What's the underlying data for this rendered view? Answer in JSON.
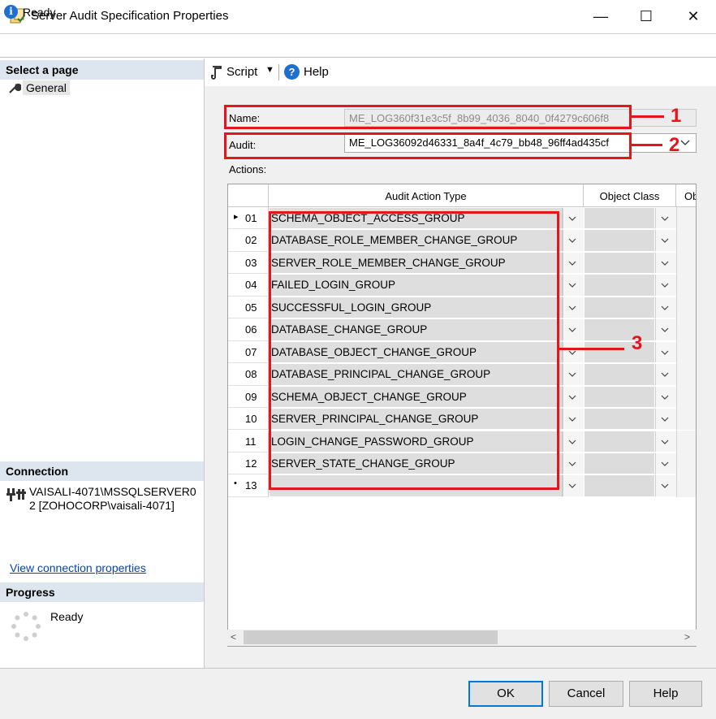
{
  "window": {
    "title": "Server Audit Specification Properties",
    "minimize": "—",
    "maximize": "☐",
    "close": "✕"
  },
  "status": {
    "text": "Ready"
  },
  "left": {
    "select_page": "Select a page",
    "pages": [
      {
        "label": "General"
      }
    ],
    "connection_header": "Connection",
    "connection_text": "VAISALI-4071\\MSSQLSERVER02 [ZOHOCORP\\vaisali-4071]",
    "view_connection": "View connection properties",
    "progress_header": "Progress",
    "progress_text": "Ready"
  },
  "toolbar": {
    "script": "Script",
    "help": "Help"
  },
  "form": {
    "name_label": "Name:",
    "name_value": "ME_LOG360f31e3c5f_8b99_4036_8040_0f4279c606f8",
    "audit_label": "Audit:",
    "audit_value": "ME_LOG36092d46331_8a4f_4c79_bb48_96ff4ad435cf",
    "actions_label": "Actions:"
  },
  "grid": {
    "columns": [
      "Audit Action Type",
      "Object Class",
      "Ob"
    ],
    "rows": [
      {
        "num": "01",
        "action": "SCHEMA_OBJECT_ACCESS_GROUP"
      },
      {
        "num": "02",
        "action": "DATABASE_ROLE_MEMBER_CHANGE_GROUP"
      },
      {
        "num": "03",
        "action": "SERVER_ROLE_MEMBER_CHANGE_GROUP"
      },
      {
        "num": "04",
        "action": "FAILED_LOGIN_GROUP"
      },
      {
        "num": "05",
        "action": "SUCCESSFUL_LOGIN_GROUP"
      },
      {
        "num": "06",
        "action": "DATABASE_CHANGE_GROUP"
      },
      {
        "num": "07",
        "action": "DATABASE_OBJECT_CHANGE_GROUP"
      },
      {
        "num": "08",
        "action": "DATABASE_PRINCIPAL_CHANGE_GROUP"
      },
      {
        "num": "09",
        "action": "SCHEMA_OBJECT_CHANGE_GROUP"
      },
      {
        "num": "10",
        "action": "SERVER_PRINCIPAL_CHANGE_GROUP"
      },
      {
        "num": "11",
        "action": "LOGIN_CHANGE_PASSWORD_GROUP"
      },
      {
        "num": "12",
        "action": "SERVER_STATE_CHANGE_GROUP"
      },
      {
        "num": "13",
        "action": ""
      }
    ],
    "current_row_marker": "▸",
    "new_row_marker": "•"
  },
  "annotations": [
    "1",
    "2",
    "3"
  ],
  "buttons": {
    "ok": "OK",
    "cancel": "Cancel",
    "help": "Help"
  },
  "colors": {
    "annotation_red": "#e8141c",
    "accent_blue": "#0078d7",
    "link_blue": "#0645ad"
  }
}
